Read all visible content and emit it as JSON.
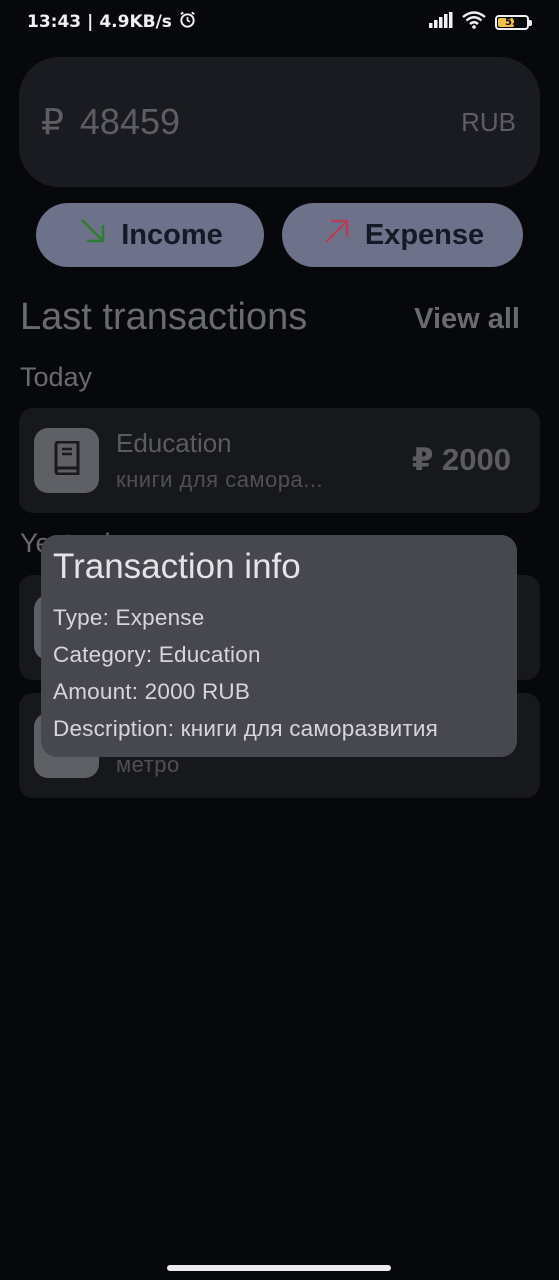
{
  "status_bar": {
    "time": "13:43",
    "separator": "|",
    "network_speed": "4.9KB/s",
    "battery_level": "52",
    "icons": [
      "alarm-icon",
      "signal-icon",
      "wifi-icon",
      "battery-icon"
    ]
  },
  "balance": {
    "symbol": "₽",
    "amount": "48459",
    "currency": "RUB"
  },
  "actions": {
    "income_label": "Income",
    "expense_label": "Expense",
    "income_arrow_color": "#2e7d32",
    "expense_arrow_color": "#b2405a"
  },
  "transactions_section": {
    "title": "Last transactions",
    "view_all_label": "View all",
    "groups": [
      {
        "label": "Today"
      },
      {
        "label": "Yesterday"
      }
    ],
    "items": [
      {
        "category": "Education",
        "description": "книги для самора...",
        "amount": "₽ 2000",
        "icon": "book-icon"
      },
      {
        "category": "",
        "description": "",
        "amount": "",
        "icon": ""
      },
      {
        "category": "",
        "description": "метро",
        "amount": "",
        "icon": "transport-icon"
      }
    ]
  },
  "dialog": {
    "title": "Transaction info",
    "type_line": "Type: Expense",
    "category_line": "Category: Education",
    "amount_line": "Amount: 2000 RUB",
    "description_line": "Description: книги для саморазвития"
  },
  "colors": {
    "background": "#07080c",
    "card": "#1a1b20",
    "button": "#6d7189",
    "dialog": "#47484f"
  }
}
